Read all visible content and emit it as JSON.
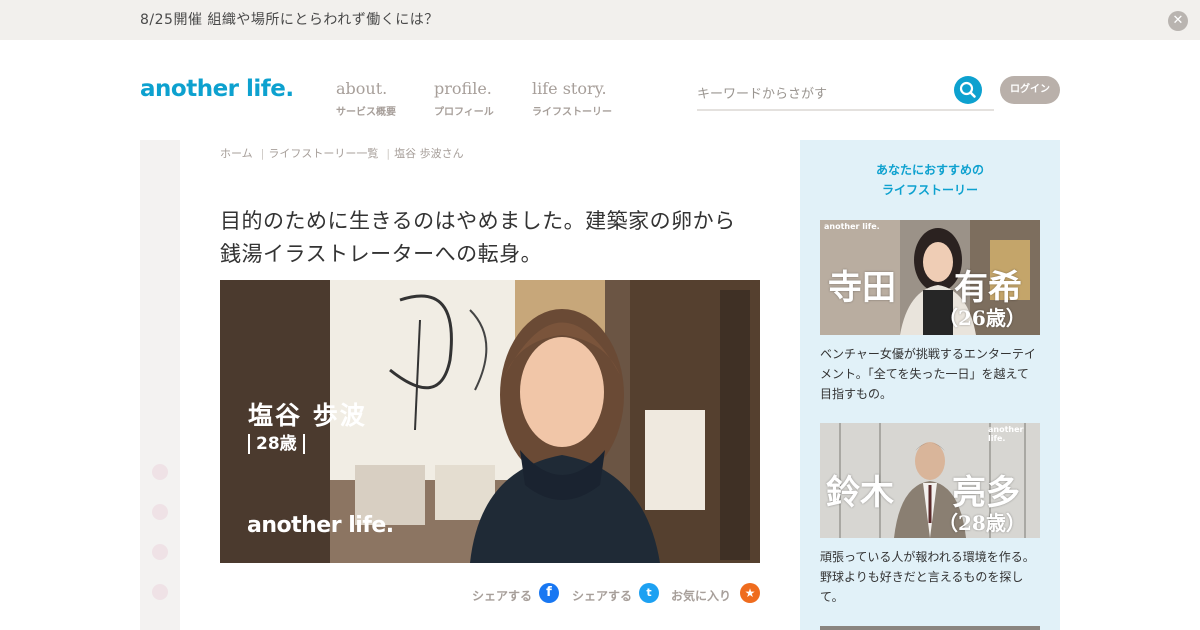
{
  "announcement": {
    "text": "8/25開催 組織や場所にとらわれず働くには？",
    "close_icon": "close-icon"
  },
  "header": {
    "logo": "another life.",
    "nav": [
      {
        "label": "about.",
        "sub": "サービス概要"
      },
      {
        "label": "profile.",
        "sub": "プロフィール"
      },
      {
        "label": "life story.",
        "sub": "ライフストーリー"
      }
    ],
    "search_placeholder": "キーワードからさがす",
    "login_label": "ログイン"
  },
  "breadcrumb": [
    "ホーム",
    "ライフストーリー一覧",
    "塩谷 歩波さん"
  ],
  "article": {
    "title_line1": "目的のために生きるのはやめました。建築家の卵から",
    "title_line2": "銭湯イラストレーターへの転身。",
    "hero": {
      "name": "塩谷 歩波",
      "age": "28歳",
      "logo": "another life."
    },
    "share": {
      "facebook_label": "シェアする",
      "twitter_label": "シェアする",
      "favorite_label": "お気に入り"
    }
  },
  "sidebar": {
    "heading_line1": "あなたにおすすめの",
    "heading_line2": "ライフストーリー",
    "cards": [
      {
        "name_left": "寺田",
        "name_right": "有希",
        "age": "（26歳）",
        "logo": "another life.",
        "desc": "ベンチャー女優が挑戦するエンターテイメント。「全てを失った一日」を越えて目指すもの。"
      },
      {
        "name_left": "鈴木",
        "name_right": "亮多",
        "age": "（28歳）",
        "logo": "another life.",
        "desc": "頑張っている人が報われる環境を作る。野球よりも好きだと言えるものを探して。"
      }
    ]
  },
  "colors": {
    "brand": "#0da1cf",
    "nav_text": "#a79f9a",
    "sidebar_bg": "#e1f1f8",
    "facebook": "#1877f2",
    "twitter": "#1da1f2",
    "favorite": "#ef6c1e"
  }
}
